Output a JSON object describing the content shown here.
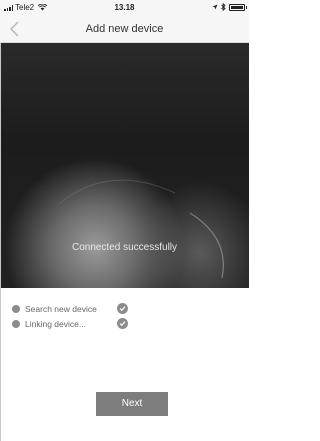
{
  "status_bar": {
    "carrier": "Tele2",
    "time": "13.18",
    "icons": [
      "signal-icon",
      "wifi-icon",
      "location-icon",
      "bluetooth-icon",
      "battery-icon"
    ]
  },
  "nav": {
    "title": "Add new device",
    "back_icon": "chevron-left-icon"
  },
  "hero": {
    "caption": "Connected successfully"
  },
  "steps": [
    {
      "label": "Search new device",
      "status": "done",
      "icon": "check-icon"
    },
    {
      "label": "Linking device...",
      "status": "done",
      "icon": "check-icon"
    }
  ],
  "actions": {
    "next_label": "Next"
  },
  "colors": {
    "nav_background": "#f6f6f6",
    "button_background": "#7d7d7d",
    "step_indicator": "#8c8c8c"
  }
}
